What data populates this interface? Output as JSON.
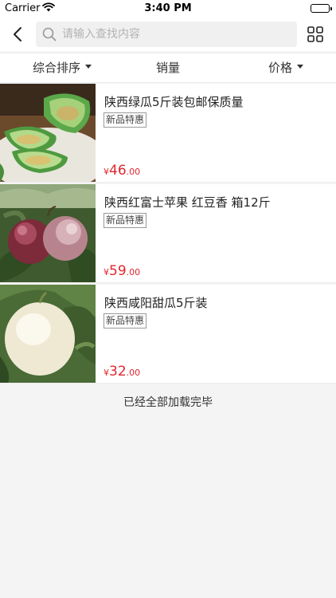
{
  "status_bar": {
    "carrier": "Carrier",
    "time": "3:40 PM"
  },
  "nav": {
    "search_placeholder": "请输入查找内容",
    "back_icon": "chevron-left-icon",
    "search_icon": "search-icon",
    "grid_icon": "grid-icon"
  },
  "sort": {
    "items": [
      {
        "label": "综合排序",
        "has_caret": true
      },
      {
        "label": "销量",
        "has_caret": false
      },
      {
        "label": "价格",
        "has_caret": true
      }
    ]
  },
  "products": [
    {
      "title": "陕西绿瓜5斤装包邮保质量",
      "tag": "新品特惠",
      "price_currency": "¥",
      "price_int": "46",
      "price_dec": ".00"
    },
    {
      "title": "陕西红富士苹果 红豆香 箱12斤",
      "tag": "新品特惠",
      "price_currency": "¥",
      "price_int": "59",
      "price_dec": ".00"
    },
    {
      "title": "陕西咸阳甜瓜5斤装",
      "tag": "新品特惠",
      "price_currency": "¥",
      "price_int": "32",
      "price_dec": ".00"
    }
  ],
  "footer": {
    "end_text": "已经全部加载完毕"
  },
  "colors": {
    "price": "#e0262e",
    "background": "#f4f4f4"
  }
}
